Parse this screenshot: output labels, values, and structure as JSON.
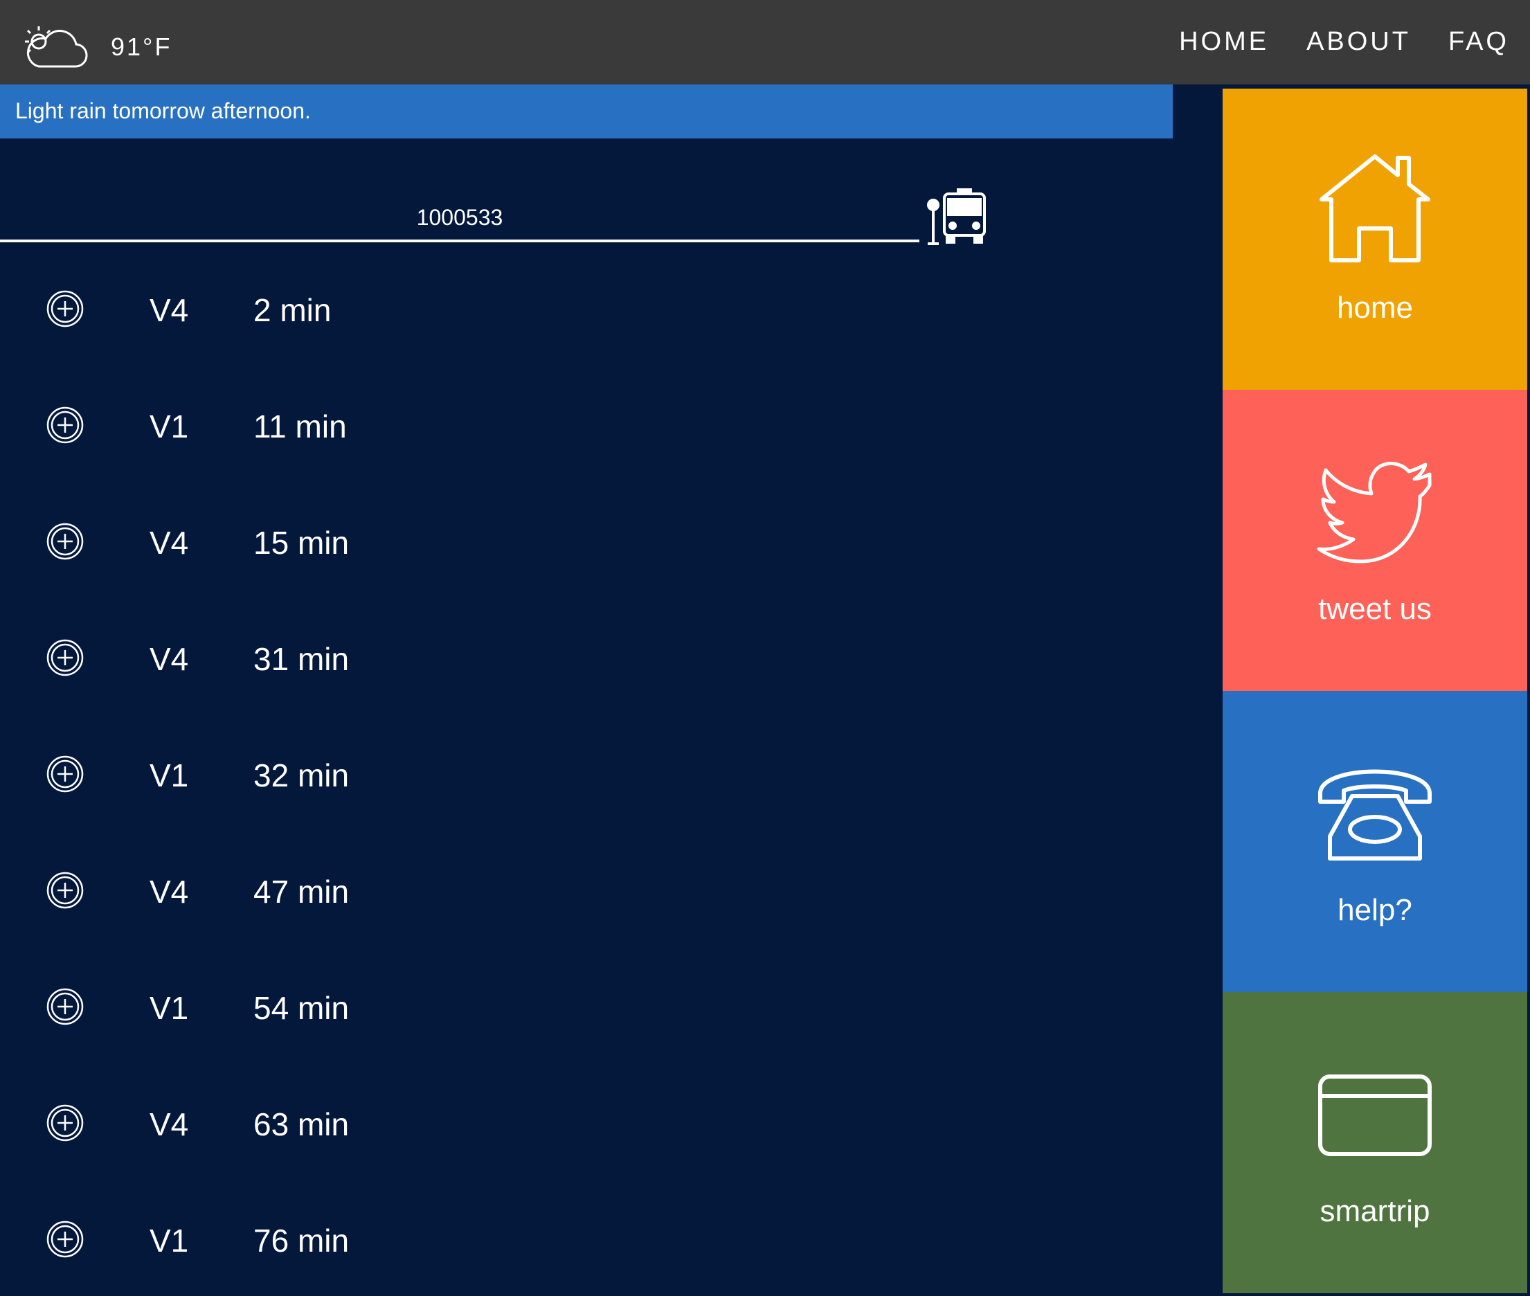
{
  "header": {
    "temperature": "91°F",
    "weather_icon": "partly-cloudy-sun-icon",
    "nav": [
      "HOME",
      "ABOUT",
      "FAQ"
    ]
  },
  "alert": {
    "text": "Light rain tomorrow afternoon."
  },
  "stop": {
    "value": "1000533",
    "icon": "bus-stop-icon"
  },
  "arrivals": [
    {
      "route": "V4",
      "eta": "2 min"
    },
    {
      "route": "V1",
      "eta": "11 min"
    },
    {
      "route": "V4",
      "eta": "15 min"
    },
    {
      "route": "V4",
      "eta": "31 min"
    },
    {
      "route": "V1",
      "eta": "32 min"
    },
    {
      "route": "V4",
      "eta": "47 min"
    },
    {
      "route": "V1",
      "eta": "54 min"
    },
    {
      "route": "V4",
      "eta": "63 min"
    },
    {
      "route": "V1",
      "eta": "76 min"
    }
  ],
  "tiles": [
    {
      "label": "home",
      "icon": "house-icon",
      "color": "#f0a202"
    },
    {
      "label": "tweet us",
      "icon": "twitter-bird-icon",
      "color": "#fe6157"
    },
    {
      "label": "help?",
      "icon": "telephone-icon",
      "color": "#2870c1"
    },
    {
      "label": "smartrip",
      "icon": "card-icon",
      "color": "#507440"
    }
  ]
}
